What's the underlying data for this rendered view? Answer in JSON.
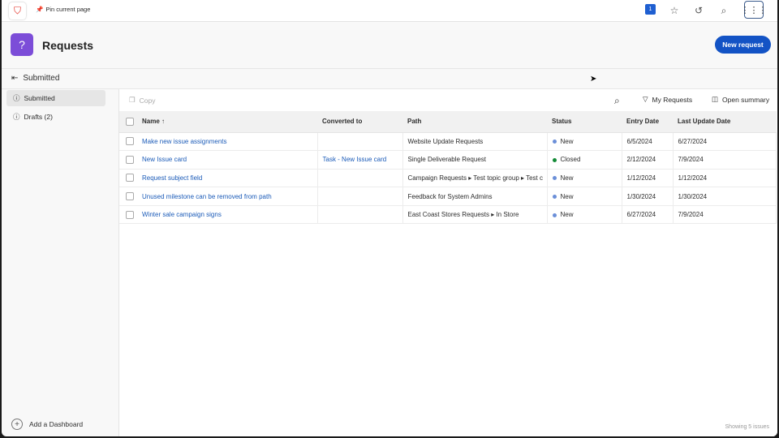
{
  "topbar": {
    "pin_label": "Pin current page",
    "badge": "1"
  },
  "header": {
    "title": "Requests",
    "new_button": "New request"
  },
  "breadcrumb": "Submitted",
  "sidebar": {
    "items": [
      {
        "label": "Submitted"
      },
      {
        "label": "Drafts (2)"
      }
    ],
    "add_dashboard": "Add a Dashboard"
  },
  "toolbar": {
    "copy": "Copy",
    "my_requests": "My Requests",
    "open_summary": "Open summary"
  },
  "table": {
    "columns": [
      "Name ↑",
      "Converted to",
      "Path",
      "Status",
      "Entry Date",
      "Last Update Date"
    ],
    "rows": [
      {
        "name": "Make new issue assignments",
        "converted": "",
        "path": "Website Update Requests",
        "status": "New",
        "entry": "6/5/2024",
        "last": "6/27/2024"
      },
      {
        "name": "New Issue card",
        "converted": "Task - New Issue card",
        "path": "Single Deliverable Request",
        "status": "Closed",
        "entry": "2/12/2024",
        "last": "7/9/2024"
      },
      {
        "name": "Request subject field",
        "converted": "",
        "path": "Campaign Requests ▸ Test topic group ▸ Test c",
        "status": "New",
        "entry": "1/12/2024",
        "last": "1/12/2024"
      },
      {
        "name": "Unused milestone can be removed from path",
        "converted": "",
        "path": "Feedback for System Admins",
        "status": "New",
        "entry": "1/30/2024",
        "last": "1/30/2024"
      },
      {
        "name": "Winter sale campaign signs",
        "converted": "",
        "path": "East Coast Stores Requests ▸ In Store",
        "status": "New",
        "entry": "6/27/2024",
        "last": "7/9/2024"
      }
    ]
  },
  "status_colors": {
    "New": "#6b8fd8",
    "Closed": "#138a36"
  },
  "footer": "Showing 5 issues"
}
